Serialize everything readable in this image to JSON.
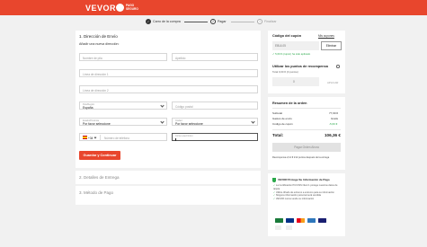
{
  "header": {
    "brand": "VEVOR",
    "badge_text": "PAGO SEGURO"
  },
  "steps": [
    {
      "num": "1",
      "label": "Carro de la compra",
      "state": "done"
    },
    {
      "num": "2",
      "label": "Pagar",
      "state": "active"
    },
    {
      "num": "3",
      "label": "Finalizar",
      "state": "inactive"
    }
  ],
  "shipping": {
    "title": "1. Dirección de Envío",
    "subtitle": "Añadir una nueva dirección:",
    "first_name_placeholder": "Nombre de pila",
    "last_name_placeholder": "Apellido",
    "address1_placeholder": "Línea de dirección 1",
    "address2_placeholder": "Línea de dirección 2",
    "country_label": "País/Región",
    "country_value": "España",
    "zip_placeholder": "Código postal",
    "province_label": "Estado/Provincia",
    "province_value": "Por favor seleccione",
    "city_label": "Ciudad",
    "city_value": "Por favor seleccione",
    "phone_prefix": "+34",
    "phone_placeholder": "Número de teléfono",
    "email_label": "Correo electrónico",
    "save_button": "Guardar y Continuar"
  },
  "delivery": {
    "title": "2. Detalles de Entrega"
  },
  "payment": {
    "title": "3. Método de Pago"
  },
  "coupon": {
    "title": "Código del cupón",
    "my_coupons": "Mis cupones",
    "code": "EBUL05",
    "remove_button": "Eliminar",
    "applied_msg": "✓ 5,60 € (cupón) ha sido aplicado"
  },
  "points": {
    "title": "Utilizar los puntos de recompensa",
    "total": "Total 0,00 € (0 puntos)",
    "value": "0",
    "apply_button": "APLICAR"
  },
  "summary": {
    "title": "Resumen de la orden",
    "subtotal_label": "Subtotal",
    "subtotal_value": "77,99 €",
    "shipping_label": "Gastos de envío",
    "shipping_value": "Gratis",
    "coupon_label": "Código de cupón",
    "coupon_value": "-5,60 €",
    "total_label": "Total:",
    "total_value": "106,36 €",
    "pay_button": "Pagar Orden Ahora",
    "reward_note": "Recompensa 2,12 € 212 puntos después de la entrega"
  },
  "protect": {
    "title": "VEVOR Protege Su Información de Pago",
    "bullets": [
      "La Certificación PCI DSS Nivel 1 protege nuestros datos de tarjeta",
      "Utiliza cifrado de extremo a extremo para su información",
      "Ninguna información personal será vendida",
      "VEVOR nunca vende su información"
    ]
  },
  "colors": {
    "brand": "#e8462d",
    "success": "#2aa84a"
  }
}
